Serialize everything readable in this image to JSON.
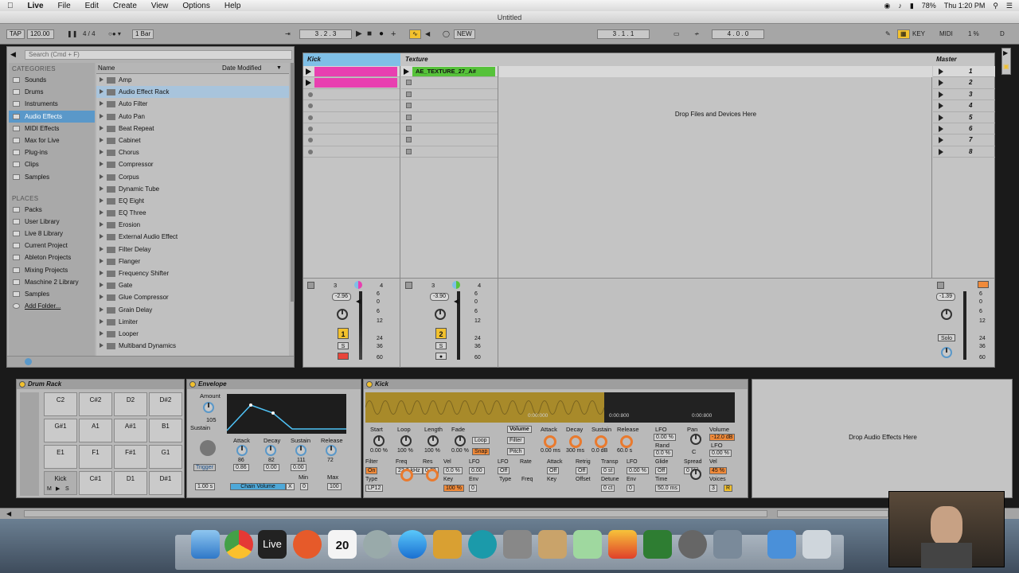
{
  "menubar": {
    "apple": "",
    "app": "Live",
    "items": [
      "File",
      "Edit",
      "Create",
      "View",
      "Options",
      "Help"
    ],
    "clock": "Thu 1:20 PM",
    "battery": "78%"
  },
  "window_title": "Untitled",
  "control_bar": {
    "tap": "TAP",
    "tempo": "120.00",
    "signature": "4 / 4",
    "quantize": "1 Bar",
    "position": "3 .   2 .   3",
    "new": "NEW",
    "loop_start": "3 .   1 .   1",
    "loop_length": "4 .   0 .   0",
    "key": "KEY",
    "midi": "MIDI",
    "cpu": "1 %",
    "d": "D"
  },
  "browser": {
    "search_placeholder": "Search (Cmd + F)",
    "categories_header": "CATEGORIES",
    "categories": [
      "Sounds",
      "Drums",
      "Instruments",
      "Audio Effects",
      "MIDI Effects",
      "Max for Live",
      "Plug-ins",
      "Clips",
      "Samples"
    ],
    "places_header": "PLACES",
    "places": [
      "Packs",
      "User Library",
      "Live 8 Library",
      "Current Project",
      "Ableton Projects",
      "Mixing Projects",
      "Maschine 2 Library",
      "Samples",
      "Add Folder..."
    ],
    "col_name": "Name",
    "col_date": "Date Modified",
    "items": [
      "Amp",
      "Audio Effect Rack",
      "Auto Filter",
      "Auto Pan",
      "Beat Repeat",
      "Cabinet",
      "Chorus",
      "Compressor",
      "Corpus",
      "Dynamic Tube",
      "EQ Eight",
      "EQ Three",
      "Erosion",
      "External Audio Effect",
      "Filter Delay",
      "Flanger",
      "Frequency Shifter",
      "Gate",
      "Glue Compressor",
      "Grain Delay",
      "Limiter",
      "Looper",
      "Multiband Dynamics"
    ]
  },
  "session": {
    "tracks": [
      {
        "name": "Kick",
        "color": "#e83fb0",
        "clip_count": 2,
        "volume": "-2.96",
        "number": "1",
        "db_scale": [
          "6",
          "0",
          "6",
          "12",
          "24",
          "36",
          "60"
        ],
        "io": [
          "3",
          "4"
        ]
      },
      {
        "name": "Texture",
        "color": "#56c23a",
        "clip": "AE_TEXTURE_27_A#",
        "volume": "-3.90",
        "number": "2",
        "db_scale": [
          "6",
          "0",
          "6",
          "12",
          "24",
          "36",
          "60"
        ],
        "io": [
          "3",
          "4"
        ]
      }
    ],
    "drop_text": "Drop Files and Devices Here",
    "master": {
      "name": "Master",
      "scenes": [
        "1",
        "2",
        "3",
        "4",
        "5",
        "6",
        "7",
        "8"
      ],
      "volume": "-1.39",
      "solo": "Solo",
      "db_scale": [
        "6",
        "0",
        "6",
        "12",
        "24",
        "36",
        "60"
      ]
    },
    "s_label": "S"
  },
  "drum_rack": {
    "title": "Drum Rack",
    "pads": [
      [
        "C2",
        "C#2",
        "D2",
        "D#2"
      ],
      [
        "G#1",
        "A1",
        "A#1",
        "B1"
      ],
      [
        "E1",
        "F1",
        "F#1",
        "G1"
      ],
      [
        "Kick",
        "C#1",
        "D1",
        "D#1"
      ]
    ],
    "m": "M",
    "s": "S"
  },
  "envelope": {
    "title": "Envelope",
    "amount_label": "Amount",
    "amount": "105",
    "sustain_label": "Sustain",
    "params": [
      "Attack",
      "Decay",
      "Sustain",
      "Release"
    ],
    "values": [
      "86",
      "82",
      "111",
      "72"
    ],
    "trigger": "Trigger",
    "v1": "0.86",
    "v2": "0.00",
    "v3": "0.00",
    "time": "1.00 s",
    "chain": "Chain Volume",
    "x": "X",
    "min_label": "Min",
    "max_label": "Max",
    "min": "0",
    "max": "100"
  },
  "simpler": {
    "title": "Kick",
    "marker1": "0:00:000",
    "marker2": "0:00:800",
    "row1": [
      "Start",
      "Loop",
      "Length",
      "Fade"
    ],
    "row1v": [
      "0.00 %",
      "100 %",
      "100 %",
      "0.00 %"
    ],
    "loop": "Loop",
    "filter_btn": "Filter",
    "pitch_btn": "Pitch",
    "snap": "Snap",
    "volume_btn": "Volume",
    "env": [
      "Attack",
      "Decay",
      "Sustain",
      "Release"
    ],
    "envv": [
      "0.00 ms",
      "300 ms",
      "0.0 dB",
      "60.0 s"
    ],
    "lfo": "LFO",
    "lfov": "0.00 %",
    "rand": "Rand",
    "randv": "0.0 %",
    "pan": "Pan",
    "panv": "C",
    "vol": "Volume",
    "volv": "-12.0 dB",
    "lfo2": "LFO",
    "lfo2v": "0.00 %",
    "row3": [
      "Filter",
      "Freq",
      "Res",
      "Vel",
      "LFO",
      "LFO",
      "Rate",
      "Attack",
      "Retrig",
      "Transp",
      "LFO",
      "Glide",
      "Spread",
      "Vel"
    ],
    "row3v": [
      "On",
      "22.0 kHz",
      "0.70",
      "0.0 %",
      "0.00",
      "Off",
      "",
      "Off",
      "Off",
      "0 st",
      "0.00 %",
      "Off",
      "0 %",
      "45 %"
    ],
    "row4": [
      "Type",
      "Key",
      "Env",
      "Type",
      "Freq",
      "Key",
      "Offset",
      "Detune",
      "Env",
      "Time",
      "Voices"
    ],
    "row4v": [
      "LP12",
      "100 %",
      "0",
      "",
      "",
      "",
      "",
      "0 ct",
      "0",
      "50.0 ms",
      "3"
    ],
    "r": "R"
  },
  "audio_fx_drop": "Drop Audio Effects Here",
  "dock": {
    "live_label": "Live",
    "calendar_day": "20"
  }
}
